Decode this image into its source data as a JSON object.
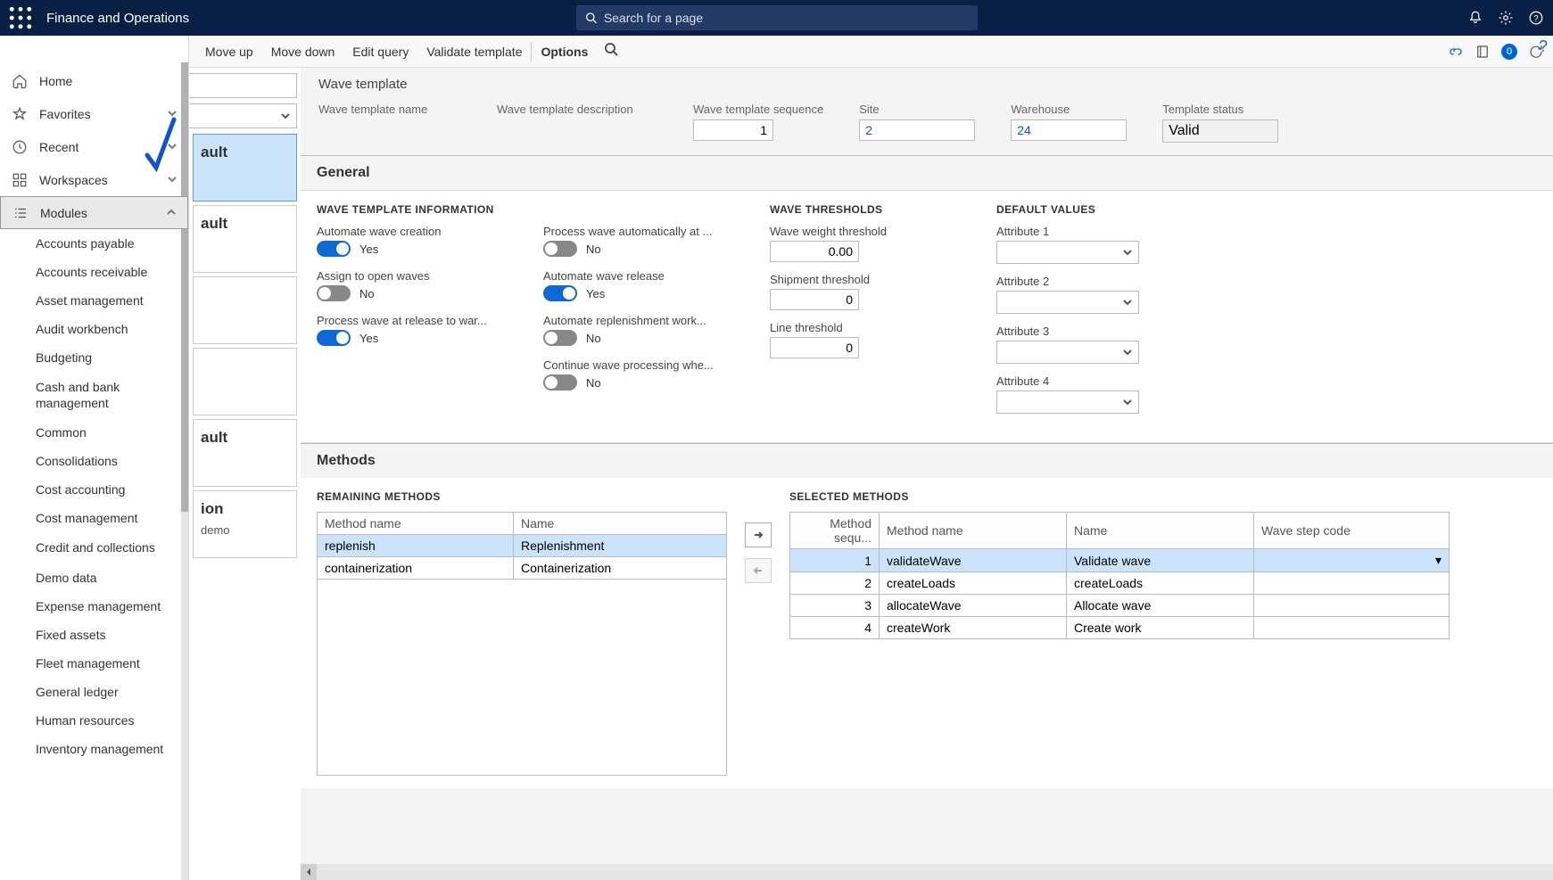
{
  "titlebar": {
    "appTitle": "Finance and Operations",
    "searchPlaceholder": "Search for a page"
  },
  "actionbar": {
    "cmds": [
      "Move up",
      "Move down",
      "Edit query",
      "Validate template",
      "Options"
    ]
  },
  "leftnav": {
    "items": [
      "Home",
      "Favorites",
      "Recent",
      "Workspaces",
      "Modules"
    ],
    "modules": [
      "Accounts payable",
      "Accounts receivable",
      "Asset management",
      "Audit workbench",
      "Budgeting",
      "Cash and bank management",
      "Common",
      "Consolidations",
      "Cost accounting",
      "Cost management",
      "Credit and collections",
      "Demo data",
      "Expense management",
      "Fixed assets",
      "Fleet management",
      "General ledger",
      "Human resources",
      "Inventory management"
    ]
  },
  "midcards": [
    {
      "title": "ault",
      "sub": ""
    },
    {
      "title": "ault",
      "sub": ""
    },
    {
      "title": "",
      "sub": ""
    },
    {
      "title": "",
      "sub": ""
    },
    {
      "title": "ault",
      "sub": ""
    },
    {
      "title": "ion",
      "sub": "demo"
    }
  ],
  "waveTemplate": {
    "sectionTitle": "Wave template",
    "nameLabel": "Wave template name",
    "descLabel": "Wave template description",
    "seqLabel": "Wave template sequence",
    "seqValue": "1",
    "siteLabel": "Site",
    "siteValue": "2",
    "whLabel": "Warehouse",
    "whValue": "24",
    "statusLabel": "Template status",
    "statusValue": "Valid"
  },
  "general": {
    "title": "General",
    "info": {
      "hdr": "WAVE TEMPLATE INFORMATION",
      "automateCreation": {
        "label": "Automate wave creation",
        "on": true,
        "txt": "Yes"
      },
      "assignOpen": {
        "label": "Assign to open waves",
        "on": false,
        "txt": "No"
      },
      "processRelease": {
        "label": "Process wave at release to war...",
        "on": true,
        "txt": "Yes"
      }
    },
    "col2": {
      "processAuto": {
        "label": "Process wave automatically at ...",
        "on": false,
        "txt": "No"
      },
      "autoRelease": {
        "label": "Automate wave release",
        "on": true,
        "txt": "Yes"
      },
      "autoReplenish": {
        "label": "Automate replenishment work...",
        "on": false,
        "txt": "No"
      },
      "continueProc": {
        "label": "Continue wave processing whe...",
        "on": false,
        "txt": "No"
      }
    },
    "thresholds": {
      "hdr": "WAVE THRESHOLDS",
      "weight": {
        "label": "Wave weight threshold",
        "val": "0.00"
      },
      "shipment": {
        "label": "Shipment threshold",
        "val": "0"
      },
      "line": {
        "label": "Line threshold",
        "val": "0"
      }
    },
    "defaults": {
      "hdr": "DEFAULT VALUES",
      "attrs": [
        "Attribute 1",
        "Attribute 2",
        "Attribute 3",
        "Attribute 4"
      ]
    }
  },
  "methods": {
    "title": "Methods",
    "remaining": {
      "hdr": "REMAINING METHODS",
      "cols": [
        "Method name",
        "Name"
      ],
      "rows": [
        {
          "method": "replenish",
          "name": "Replenishment",
          "sel": true
        },
        {
          "method": "containerization",
          "name": "Containerization",
          "sel": false
        }
      ]
    },
    "selected": {
      "hdr": "SELECTED METHODS",
      "cols": [
        "Method sequ...",
        "Method name",
        "Name",
        "Wave step code"
      ],
      "rows": [
        {
          "seq": "1",
          "method": "validateWave",
          "name": "Validate wave"
        },
        {
          "seq": "2",
          "method": "createLoads",
          "name": "createLoads"
        },
        {
          "seq": "3",
          "method": "allocateWave",
          "name": "Allocate wave"
        },
        {
          "seq": "4",
          "method": "createWork",
          "name": "Create work"
        }
      ]
    }
  }
}
